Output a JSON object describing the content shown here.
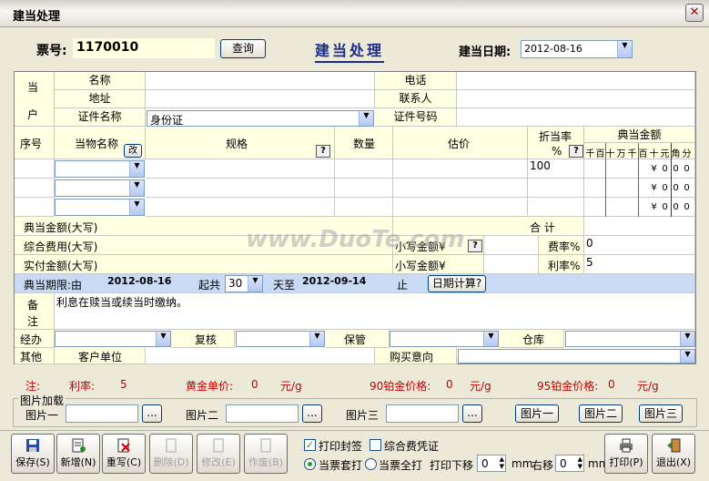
{
  "window": {
    "title": "建当处理",
    "close_glyph": "✕"
  },
  "ticket": {
    "label": "票号:",
    "number": "1170010",
    "query_button": "查询",
    "form_title": "建当处理",
    "date_label": "建当日期:",
    "date_value": "2012-08-16"
  },
  "customer": {
    "group_label_1": "当",
    "group_label_2": "户",
    "name_label": "名称",
    "name_value": "",
    "address_label": "地址",
    "address_value": "",
    "id_type_label": "证件名称",
    "id_type_value": "身份证",
    "phone_label": "电话",
    "phone_value": "",
    "contact_label": "联系人",
    "contact_value": "",
    "id_number_label": "证件号码",
    "id_number_value": ""
  },
  "items_table": {
    "col_seq": "序号",
    "col_item_name": "当物名称",
    "edit_button": "改",
    "col_spec": "规格",
    "col_qty": "数量",
    "col_estimate": "估价",
    "col_rate": "折当率",
    "rate_unit": "%",
    "col_amount": "典当金额",
    "digit_headers": [
      "千",
      "百",
      "十",
      "万",
      "千",
      "百",
      "十",
      "元",
      "角",
      "分"
    ],
    "q": "?",
    "rows": [
      {
        "rate": "100",
        "amount_digits": [
          "¥",
          "0",
          "0",
          "0"
        ]
      },
      {
        "rate": "",
        "amount_digits": [
          "¥",
          "0",
          "0",
          "0"
        ]
      },
      {
        "rate": "",
        "amount_digits": [
          "¥",
          "0",
          "0",
          "0"
        ]
      }
    ]
  },
  "summary": {
    "amount_caps_label": "典当金额(大写)",
    "total_label": "合     计",
    "fee_caps_label": "综合费用(大写)",
    "small_amount_label": "小写金额¥",
    "fee_rate_label": "费率%",
    "fee_rate_value": "0",
    "actual_caps_label": "实付金额(大写)",
    "small_amount_label2": "小写金额¥",
    "interest_rate_label": "利率%",
    "interest_rate_value": "5"
  },
  "term": {
    "label": "典当期限:由",
    "start_date": "2012-08-16",
    "total_label": "起共",
    "days_value": "30",
    "to_label": "天至",
    "end_date": "2012-09-14",
    "stop_label": "止",
    "date_calc_button": "日期计算?"
  },
  "remarks": {
    "label_1": "备",
    "label_2": "注",
    "text": "利息在赎当或续当时缴纳。"
  },
  "staff": {
    "handler_label": "经办",
    "reviewer_label": "复核",
    "keeper_label": "保管",
    "warehouse_label": "仓库"
  },
  "other": {
    "label": "其他",
    "client_unit_label": "客户单位",
    "purchase_intent_label": "购买意向"
  },
  "prices": {
    "note_label": "注:",
    "rate_label": "利率:",
    "rate_value": "5",
    "gold_label": "黄金单价:",
    "gold_value": "0",
    "gold_unit": "元/g",
    "pt90_label": "90铂金价格:",
    "pt90_value": "0",
    "pt90_unit": "元/g",
    "pt95_label": "95铂金价格:",
    "pt95_value": "0",
    "pt95_unit": "元/g"
  },
  "pictures": {
    "group_label": "图片加载",
    "pic1_label": "图片一",
    "pic2_label": "图片二",
    "pic3_label": "图片三",
    "browse": "...",
    "view1": "图片一",
    "view2": "图片二",
    "view3": "图片三"
  },
  "toolbar": {
    "save": "保存(S)",
    "new": "新增(N)",
    "rewrite": "重写(C)",
    "delete": "删除(D)",
    "modify": "修改(E)",
    "void": "作废(B)",
    "print_seal": "打印封签",
    "print_fee_voucher": "综合费凭证",
    "radio_set": "当票套打",
    "radio_full": "当票全打",
    "print_offset_label": "打印下移",
    "offset_down_value": "0",
    "mm1": "mm",
    "right_offset_label": "右移",
    "offset_right_value": "0",
    "mm2": "mm",
    "print": "打印(P)",
    "exit": "退出(X)",
    "watermark": "www.DuoTe.com"
  }
}
